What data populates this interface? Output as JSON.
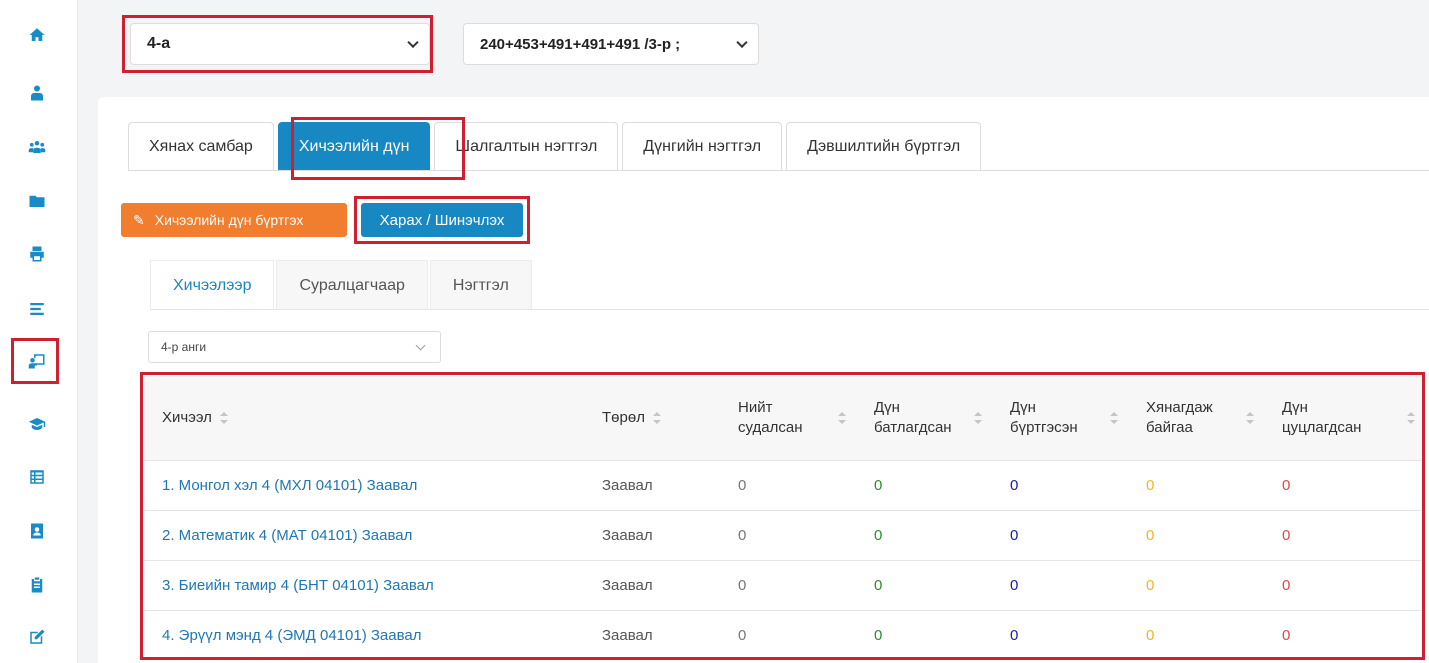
{
  "selectors": {
    "class_value": "4-а",
    "course_value": "240+453+491+491+491 /3-р ;"
  },
  "main_tabs": [
    {
      "label": "Хянах самбар"
    },
    {
      "label": "Хичээлийн дүн"
    },
    {
      "label": "Шалгалтын нэгтгэл"
    },
    {
      "label": "Дүнгийн нэгтгэл"
    },
    {
      "label": "Дэвшилтийн бүртгэл"
    }
  ],
  "buttons": {
    "register_label": "Хичээлийн дүн бүртгэх",
    "view_label": "Харах / Шинэчлэх"
  },
  "sub_tabs": [
    {
      "label": "Хичээлээр"
    },
    {
      "label": "Суралцагчаар"
    },
    {
      "label": "Нэгтгэл"
    }
  ],
  "grade_select": {
    "value": "4-р анги"
  },
  "table": {
    "headers": {
      "subject": "Хичээл",
      "type": "Төрөл",
      "total_1": "Нийт",
      "total_2": "судалсан",
      "confirmed_1": "Дүн",
      "confirmed_2": "батлагдсан",
      "registered_1": "Дүн",
      "registered_2": "бүртгэсэн",
      "reviewing_1": "Хянагдаж",
      "reviewing_2": "байгаа",
      "cancelled_1": "Дүн",
      "cancelled_2": "цуцлагдсан"
    },
    "rows": [
      {
        "subject": "1. Монгол хэл 4 (МХЛ 04101) Заавал",
        "type": "Заавал",
        "total": "0",
        "confirmed": "0",
        "registered": "0",
        "reviewing": "0",
        "cancelled": "0"
      },
      {
        "subject": "2. Математик 4 (МАТ 04101) Заавал",
        "type": "Заавал",
        "total": "0",
        "confirmed": "0",
        "registered": "0",
        "reviewing": "0",
        "cancelled": "0"
      },
      {
        "subject": "3. Биеийн тамир 4 (БНТ 04101) Заавал",
        "type": "Заавал",
        "total": "0",
        "confirmed": "0",
        "registered": "0",
        "reviewing": "0",
        "cancelled": "0"
      },
      {
        "subject": "4. Эрүүл мэнд 4 (ЭМД 04101) Заавал",
        "type": "Заавал",
        "total": "0",
        "confirmed": "0",
        "registered": "0",
        "reviewing": "0",
        "cancelled": "0"
      }
    ]
  },
  "sidebar_icons": [
    "home-icon",
    "user-tie-icon",
    "users-icon",
    "folder-icon",
    "print-icon",
    "menu-lines-icon",
    "chalkboard-teacher-icon",
    "graduation-cap-icon",
    "list-icon",
    "address-card-icon",
    "clipboard-icon",
    "edit-icon"
  ],
  "colors": {
    "accent": "#1788c2",
    "orange": "#f07e2e",
    "highlight": "#d0202f",
    "confirmed": "#2e8b2e",
    "registered": "#1a1aaa",
    "reviewing": "#f0b429",
    "cancelled": "#e04848"
  }
}
